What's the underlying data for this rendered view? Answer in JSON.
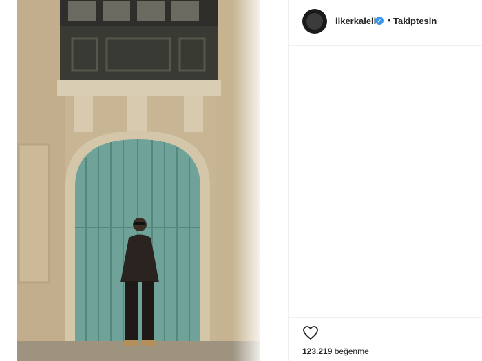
{
  "post": {
    "username": "ilkerkaleli",
    "follow_status": "Takiptesin",
    "verified_icon": "verified-badge-icon",
    "like_count": "123.219",
    "like_label": "beğenme"
  },
  "colors": {
    "door": "#6fa39a",
    "wall": "#c9b796",
    "balcony": "#3a3a34",
    "accent": "#3897f0"
  }
}
